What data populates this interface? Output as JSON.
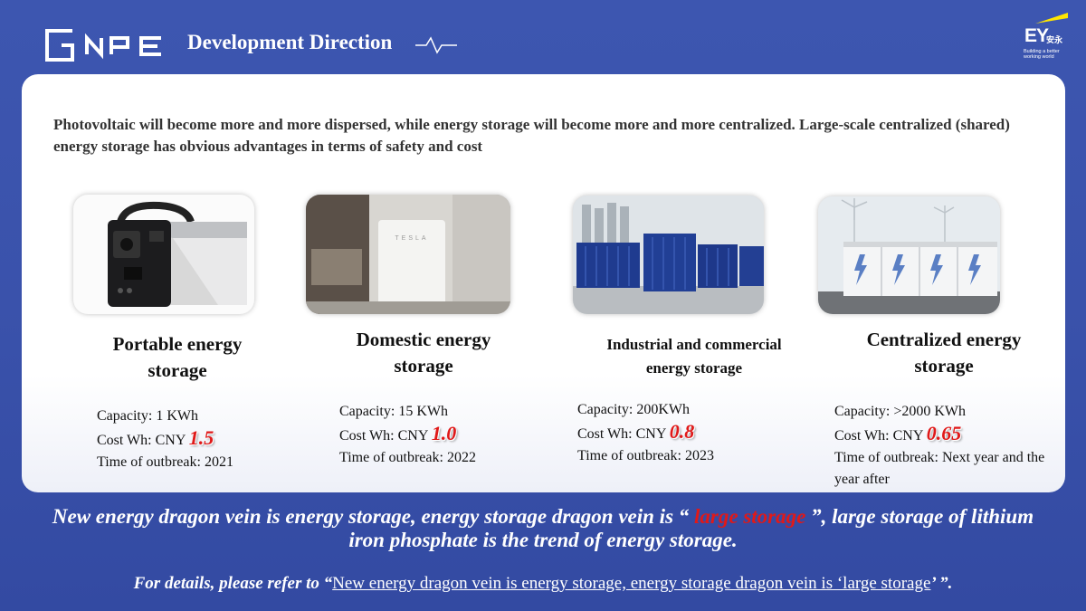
{
  "header": {
    "brand": "NPE",
    "title": "Development Direction",
    "ey": {
      "mark": "EY",
      "cn": "安永",
      "tagline": "Building a better working world"
    }
  },
  "intro": "Photovoltaic will become more and more dispersed, while energy storage will become more and more centralized. Large-scale centralized (shared) energy storage has obvious advantages in terms of safety and cost",
  "cards": [
    {
      "title": "Portable energy storage",
      "capacity": "Capacity: 1 KWh",
      "cost_label": "Cost Wh: CNY ",
      "price": "1.5",
      "outbreak": "Time of outbreak: 2021"
    },
    {
      "title": "Domestic energy storage",
      "capacity": "Capacity: 15 KWh",
      "cost_label": "Cost Wh: CNY ",
      "price": "1.0",
      "outbreak": "Time of outbreak: 2022",
      "image_text": "TESLA"
    },
    {
      "title": "Industrial and commercial energy storage",
      "capacity": "Capacity: 200KWh",
      "cost_label": "Cost Wh: CNY ",
      "price": "0.8",
      "outbreak": "Time of outbreak: 2023"
    },
    {
      "title": "Centralized energy storage",
      "capacity": "Capacity: >2000 KWh",
      "cost_label": "Cost Wh: CNY ",
      "price": "0.65",
      "outbreak": "Time of outbreak: Next year and the year after"
    }
  ],
  "footer": {
    "line1_a": "New energy dragon vein is energy storage, energy storage dragon vein is “ ",
    "line1_hl": "large storage",
    "line1_b": " ”, large storage of lithium iron phosphate is the trend of energy storage.",
    "line2_a": "For details, please refer to “",
    "line2_link": "New energy dragon vein is energy storage, energy storage dragon vein is ‘large storage",
    "line2_b": "’ ”."
  },
  "colors": {
    "background": "#3a52ab",
    "price": "#e01919",
    "ey_yellow": "#ffe600"
  }
}
